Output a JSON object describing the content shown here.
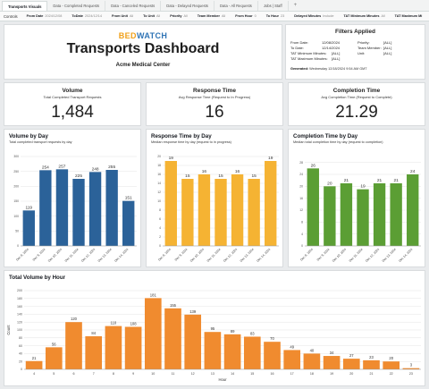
{
  "tabs": [
    {
      "label": "Transports Visuals",
      "active": true
    },
    {
      "label": "Data - Completed Requests"
    },
    {
      "label": "Data - Canceled Requests"
    },
    {
      "label": "Data - Delayed Requests"
    },
    {
      "label": "Data - All Requests"
    },
    {
      "label": "Jobs | Staff"
    },
    {
      "label": "+"
    }
  ],
  "controls": {
    "title": "Controls",
    "items": [
      {
        "key": "From Date",
        "value": "2024/12/08"
      },
      {
        "key": "ToDate",
        "value": "2024/12/14"
      },
      {
        "key": "From Unit",
        "value": "All"
      },
      {
        "key": "To Unit",
        "value": "All"
      },
      {
        "key": "Priority",
        "value": "All"
      },
      {
        "key": "Team Member",
        "value": "All"
      },
      {
        "key": "From Hour",
        "value": "0"
      },
      {
        "key": "To Hour",
        "value": "23"
      },
      {
        "key": "Delayed Minutes",
        "value": "Include"
      },
      {
        "key": "TAT Minimum Minutes",
        "value": "All"
      },
      {
        "key": "TAT Maximum Mi",
        "value": ""
      }
    ]
  },
  "header": {
    "logo_part1": "BED",
    "logo_part2": "WATCH",
    "title": "Transports Dashboard",
    "subtitle": "Acme Medical Center"
  },
  "filters": {
    "title": "Filters Applied",
    "left": [
      {
        "label": "From Date:",
        "value": "12/08/2024"
      },
      {
        "label": "To Date:",
        "value": "12/14/2024"
      },
      {
        "label": "TAT Minimum Minutes:",
        "value": "[ALL]"
      },
      {
        "label": "TAT Maximum Minutes:",
        "value": "[ALL]"
      }
    ],
    "right": [
      {
        "label": "Priority:",
        "value": "[ALL]"
      },
      {
        "label": "Team Member:",
        "value": "[ALL]"
      },
      {
        "label": "Unit:",
        "value": "[ALL]"
      }
    ],
    "generated_label": "Generated:",
    "generated_value": "Wednesday 12/18/2024 9:54 AM GMT"
  },
  "kpis": [
    {
      "title": "Volume",
      "subtitle": "Total Completed Transport Requests",
      "value": "1,484"
    },
    {
      "title": "Response Time",
      "subtitle": "Avg Response Time (Request to In Progress)",
      "value": "16"
    },
    {
      "title": "Completion Time",
      "subtitle": "Avg Completion Time (Request to Complete)",
      "value": "21.29"
    }
  ],
  "chart_data": [
    {
      "type": "bar",
      "title": "Volume by Day",
      "subtitle": "Total completed transport requests by day",
      "color": "#2b6299",
      "categories": [
        "Dec 8, 2024",
        "Dec 9, 2024",
        "Dec 10, 2024",
        "Dec 11, 2024",
        "Dec 12, 2024",
        "Dec 13, 2024",
        "Dec 14, 2024"
      ],
      "values": [
        119,
        254,
        257,
        225,
        248,
        255,
        151
      ],
      "ylim": [
        0,
        300
      ],
      "yticks": [
        0,
        50,
        100,
        150,
        200,
        250,
        300
      ]
    },
    {
      "type": "bar",
      "title": "Response Time by Day",
      "subtitle": "Median response time by day (request to in progress)",
      "color": "#f5b333",
      "categories": [
        "Dec 8, 2024",
        "Dec 9, 2024",
        "Dec 10, 2024",
        "Dec 11, 2024",
        "Dec 12, 2024",
        "Dec 13, 2024",
        "Dec 14, 2024"
      ],
      "values": [
        19,
        15,
        16,
        15,
        16,
        15,
        19
      ],
      "ylim": [
        0,
        20
      ],
      "yticks": [
        0,
        2,
        4,
        6,
        8,
        10,
        12,
        14,
        16,
        18,
        20
      ]
    },
    {
      "type": "bar",
      "title": "Completion Time by Day",
      "subtitle": "Median total completion time by day (request to completion)",
      "color": "#5b9e34",
      "categories": [
        "Dec 8, 2024",
        "Dec 9, 2024",
        "Dec 10, 2024",
        "Dec 11, 2024",
        "Dec 12, 2024",
        "Dec 13, 2024",
        "Dec 14, 2024"
      ],
      "values": [
        26,
        20,
        21,
        19,
        21,
        21,
        24
      ],
      "ylim": [
        0,
        30
      ],
      "yticks": [
        0,
        4,
        8,
        12,
        16,
        20,
        24,
        28
      ]
    },
    {
      "type": "bar",
      "title": "Total Volume by Hour",
      "subtitle": "",
      "color": "#f08b2f",
      "xlabel": "Hour",
      "ylabel": "Count",
      "categories": [
        "4",
        "5",
        "6",
        "7",
        "8",
        "9",
        "10",
        "11",
        "12",
        "13",
        "14",
        "15",
        "16",
        "17",
        "18",
        "19",
        "20",
        "21",
        "22",
        "23"
      ],
      "values": [
        21,
        56,
        120,
        84,
        110,
        108,
        181,
        155,
        139,
        95,
        89,
        83,
        70,
        49,
        40,
        34,
        27,
        23,
        20,
        3
      ],
      "ylim": [
        0,
        200
      ],
      "yticks": [
        0,
        20,
        40,
        60,
        80,
        100,
        120,
        140,
        160,
        180,
        200
      ]
    }
  ]
}
